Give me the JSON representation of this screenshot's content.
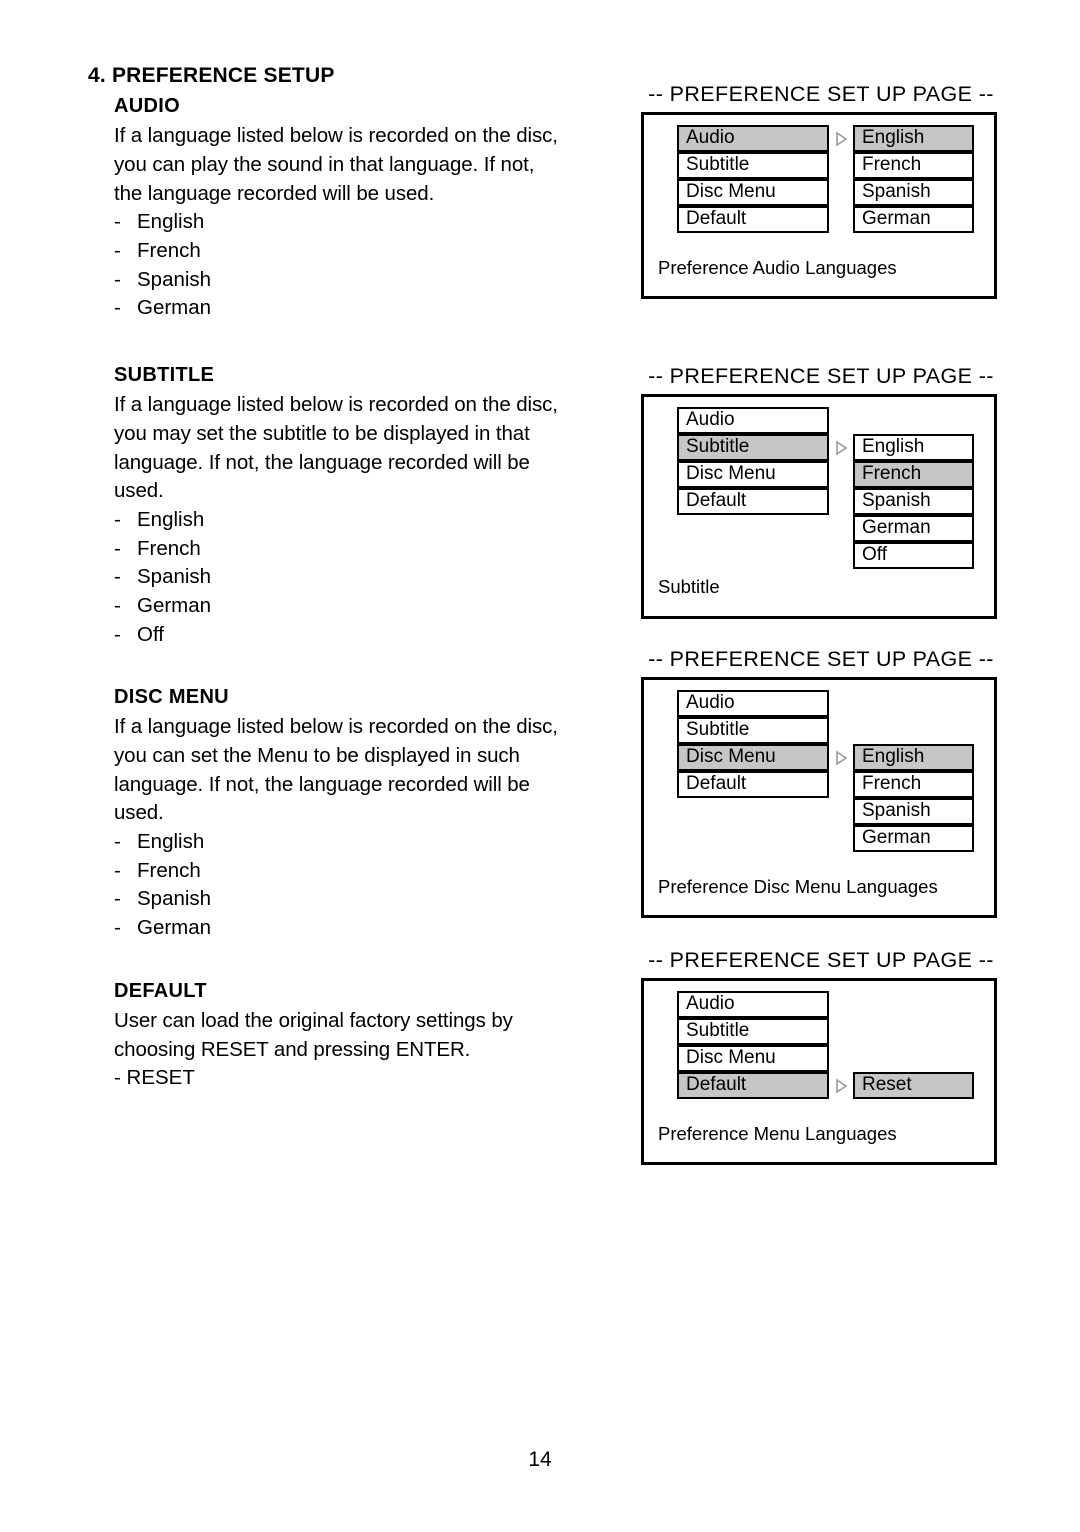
{
  "page": {
    "number": "14",
    "chapter_heading": "4. PREFERENCE SETUP"
  },
  "sections": [
    {
      "title": "AUDIO",
      "paragraph": "If a language listed below is recorded on the disc, you can play the sound in that language.  If not, the language recorded will be used.",
      "lines": [
        "If a language listed below is recorded on the disc,",
        "you can play the sound in that language.  If not,",
        "the language recorded will be used."
      ],
      "bullet_marker": "-",
      "items": [
        "English",
        "French",
        "Spanish",
        "German"
      ]
    },
    {
      "title": "SUBTITLE",
      "paragraph": "If a language listed below is recorded on the disc, you may set the subtitle to be displayed in that language. If not, the language recorded will be used.",
      "lines": [
        "If a language listed below is recorded on the disc,",
        "you may set the subtitle to be displayed in that",
        "language. If not, the language recorded will be",
        "used."
      ],
      "bullet_marker": "-",
      "items": [
        "English",
        "French",
        "Spanish",
        "German",
        "Off"
      ]
    },
    {
      "title": "DISC MENU",
      "paragraph": "If a language listed below is recorded on the disc, you can set the Menu to be displayed in such language. If not, the language recorded will be used.",
      "lines": [
        "If a language listed below is recorded on the disc,",
        "you can set the Menu to be displayed in such",
        "language. If not, the language recorded will be",
        "used."
      ],
      "bullet_marker": "-",
      "items": [
        "English",
        "French",
        "Spanish",
        "German"
      ]
    },
    {
      "title": "DEFAULT",
      "paragraph": "User can load the original factory settings by choosing RESET and pressing ENTER.",
      "lines": [
        "User can load the original factory settings by",
        "choosing RESET and pressing ENTER."
      ],
      "bullet_marker": "-",
      "items": [
        "RESET"
      ]
    }
  ],
  "diagrams": [
    {
      "title": "-- PREFERENCE SET UP PAGE --",
      "caption": "Preference Audio Languages",
      "arrow_icon": "triangle-right-icon",
      "left_menu": [
        {
          "label": "Audio",
          "highlighted": true
        },
        {
          "label": "Subtitle",
          "highlighted": false
        },
        {
          "label": "Disc Menu",
          "highlighted": false
        },
        {
          "label": "Default",
          "highlighted": false
        }
      ],
      "arrow_at_row": 0,
      "right_menu_start_row": 0,
      "right_menu": [
        {
          "label": "English",
          "highlighted": true
        },
        {
          "label": "French",
          "highlighted": false
        },
        {
          "label": "Spanish",
          "highlighted": false
        },
        {
          "label": "German",
          "highlighted": false
        }
      ]
    },
    {
      "title": "-- PREFERENCE SET UP PAGE --",
      "caption": "Subtitle",
      "arrow_icon": "triangle-right-icon",
      "left_menu": [
        {
          "label": "Audio",
          "highlighted": false
        },
        {
          "label": "Subtitle",
          "highlighted": true
        },
        {
          "label": "Disc Menu",
          "highlighted": false
        },
        {
          "label": "Default",
          "highlighted": false
        }
      ],
      "arrow_at_row": 1,
      "right_menu_start_row": 1,
      "right_menu": [
        {
          "label": "English",
          "highlighted": false
        },
        {
          "label": "French",
          "highlighted": true
        },
        {
          "label": "Spanish",
          "highlighted": false
        },
        {
          "label": "German",
          "highlighted": false
        },
        {
          "label": "Off",
          "highlighted": false
        }
      ]
    },
    {
      "title": "-- PREFERENCE SET UP PAGE --",
      "caption": "Preference Disc Menu Languages",
      "arrow_icon": "triangle-right-icon",
      "left_menu": [
        {
          "label": "Audio",
          "highlighted": false
        },
        {
          "label": "Subtitle",
          "highlighted": false
        },
        {
          "label": "Disc Menu",
          "highlighted": true
        },
        {
          "label": "Default",
          "highlighted": false
        }
      ],
      "arrow_at_row": 2,
      "right_menu_start_row": 2,
      "right_menu": [
        {
          "label": "English",
          "highlighted": true
        },
        {
          "label": "French",
          "highlighted": false
        },
        {
          "label": "Spanish",
          "highlighted": false
        },
        {
          "label": "German",
          "highlighted": false
        }
      ]
    },
    {
      "title": "-- PREFERENCE SET UP PAGE --",
      "caption": "Preference Menu Languages",
      "arrow_icon": "triangle-right-icon",
      "left_menu": [
        {
          "label": "Audio",
          "highlighted": false
        },
        {
          "label": "Subtitle",
          "highlighted": false
        },
        {
          "label": "Disc Menu",
          "highlighted": false
        },
        {
          "label": "Default",
          "highlighted": true
        }
      ],
      "arrow_at_row": 3,
      "right_menu_start_row": 3,
      "right_menu": [
        {
          "label": "Reset",
          "highlighted": true
        }
      ]
    }
  ],
  "colors": {
    "highlight": "#c6c6c6",
    "border": "#000000",
    "background": "#ffffff",
    "arrow": "#9a9a9a"
  }
}
